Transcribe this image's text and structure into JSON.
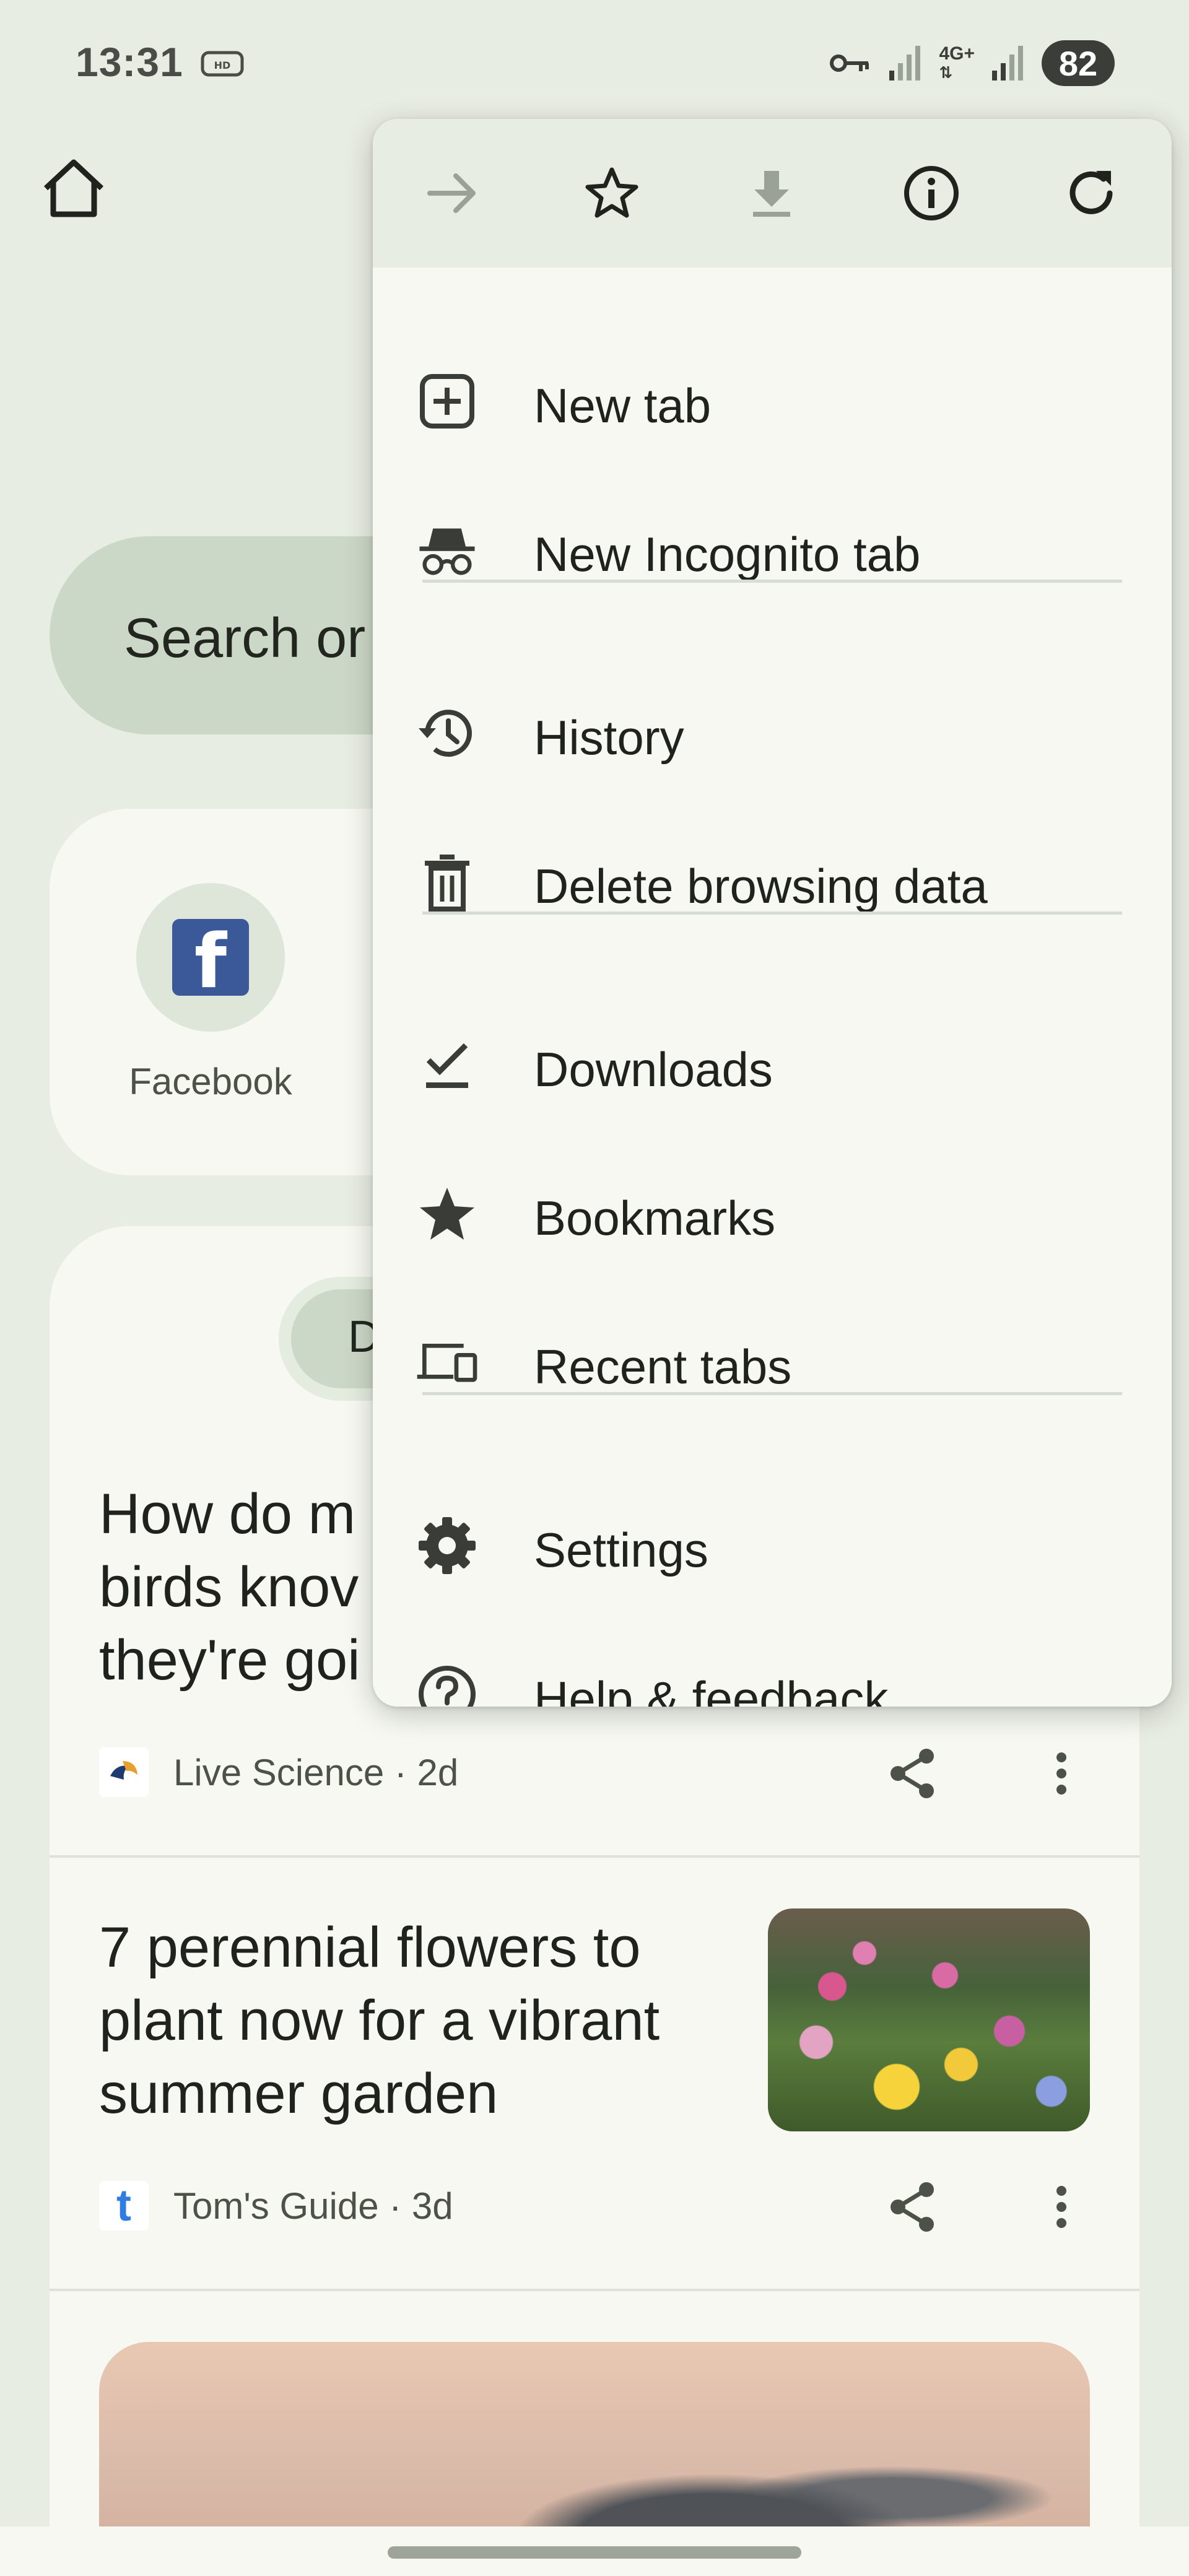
{
  "status_bar": {
    "time": "13:31",
    "battery": "82",
    "network": "4G+"
  },
  "background_page": {
    "search_placeholder": "Search or",
    "shortcuts": [
      {
        "label": "Facebook",
        "icon": "facebook-logo"
      }
    ],
    "feed_chip_label": "D",
    "articles": [
      {
        "title_lines": [
          "How do m",
          "birds knov",
          "they're goi"
        ],
        "source": "Live Science · 2d"
      },
      {
        "title_lines": [
          "7 perennial flowers to",
          "plant now for a vibrant",
          "summer garden"
        ],
        "source": "Tom's Guide · 3d",
        "source_logo_letter": "t"
      }
    ]
  },
  "menu": {
    "top_actions": [
      {
        "name": "forward-icon",
        "enabled": false
      },
      {
        "name": "star-icon",
        "enabled": true
      },
      {
        "name": "download-icon",
        "enabled": false
      },
      {
        "name": "info-icon",
        "enabled": true
      },
      {
        "name": "reload-icon",
        "enabled": true
      }
    ],
    "items": [
      {
        "label": "New tab",
        "icon": "add-box-icon"
      },
      {
        "label": "New Incognito tab",
        "icon": "incognito-icon"
      },
      {
        "label": "History",
        "icon": "history-icon"
      },
      {
        "label": "Delete browsing data",
        "icon": "trash-icon"
      },
      {
        "label": "Downloads",
        "icon": "downloads-check-icon"
      },
      {
        "label": "Bookmarks",
        "icon": "bookmark-star-icon"
      },
      {
        "label": "Recent tabs",
        "icon": "devices-icon"
      },
      {
        "label": "Settings",
        "icon": "gear-icon"
      },
      {
        "label": "Help & feedback",
        "icon": "help-icon"
      }
    ]
  },
  "colors": {
    "background": "#e8ede4",
    "surface": "#f6f8f1",
    "search_pill": "#ccd8c7",
    "text_primary": "#1f221d",
    "text_secondary": "#4d5249",
    "disabled_icon": "#9aa196"
  }
}
